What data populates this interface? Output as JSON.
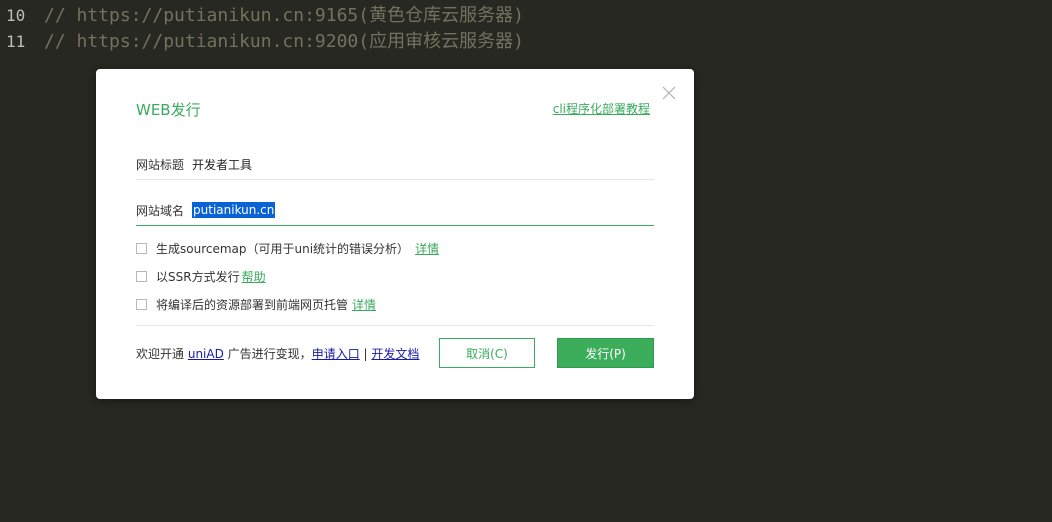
{
  "editor": {
    "lines": [
      {
        "number": "10",
        "text": "// https://putianikun.cn:9165(黄色仓库云服务器)"
      },
      {
        "number": "11",
        "text": "// https://putianikun.cn:9200(应用审核云服务器)"
      }
    ]
  },
  "dialog": {
    "title": "WEB发行",
    "cli_link": "cli程序化部署教程",
    "site_title": {
      "label": "网站标题",
      "value": "开发者工具"
    },
    "site_domain": {
      "label": "网站域名",
      "value": "putianikun.cn"
    },
    "options": [
      {
        "label": "生成sourcemap（可用于uni统计的错误分析）",
        "link": "详情",
        "checked": false
      },
      {
        "label": "以SSR方式发行",
        "link": "帮助",
        "checked": false
      },
      {
        "label": "将编译后的资源部署到前端网页托管",
        "link": "详情",
        "checked": false
      }
    ],
    "footer": {
      "prefix": "欢迎开通",
      "uniad": "uniAD",
      "middle": "广告进行变现，",
      "apply_link": "申请入口",
      "separator": "|",
      "docs_link": "开发文档"
    },
    "cancel_label": "取消(C)",
    "publish_label": "发行(P)"
  },
  "colors": {
    "accent": "#3aaa5e",
    "editor_bg": "#272822",
    "comment": "#75715e",
    "selection": "#0a63d6",
    "link_blue": "#1a1aa6"
  }
}
